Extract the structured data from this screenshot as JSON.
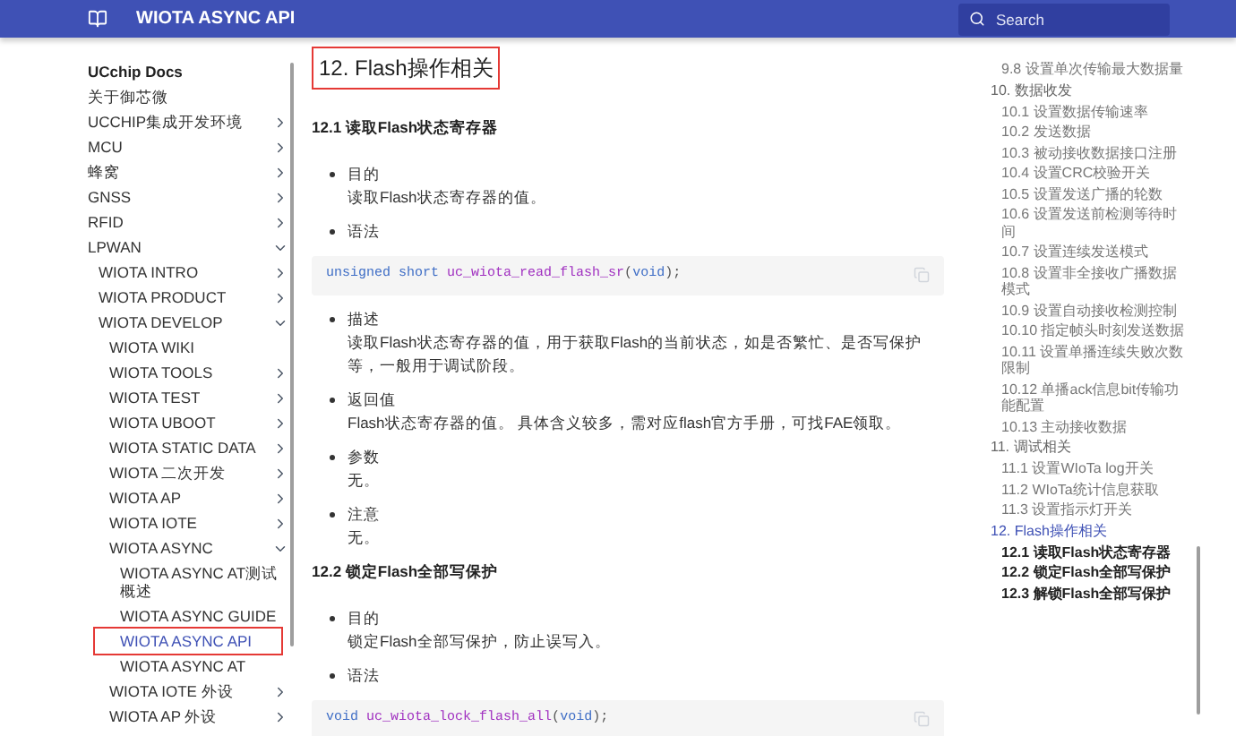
{
  "header": {
    "title": "WIOTA ASYNC API",
    "search": {
      "placeholder": "Search"
    }
  },
  "nav": {
    "title": "UCchip Docs",
    "items": [
      {
        "label": "关于御芯微",
        "selected": false
      },
      {
        "label": "UCCHIP集成开发环境",
        "expanded": false,
        "selected": false
      },
      {
        "label": "MCU",
        "expanded": false,
        "selected": false
      },
      {
        "label": "蜂窝",
        "expanded": false,
        "selected": false
      },
      {
        "label": "GNSS",
        "expanded": false,
        "selected": false
      },
      {
        "label": "RFID",
        "expanded": false,
        "selected": false
      },
      {
        "label": "LPWAN",
        "expanded": true,
        "selected": false,
        "children": [
          {
            "label": "WIOTA INTRO",
            "expanded": false,
            "selected": false
          },
          {
            "label": "WIOTA PRODUCT",
            "expanded": false,
            "selected": false
          },
          {
            "label": "WIOTA DEVELOP",
            "expanded": true,
            "selected": false,
            "children": [
              {
                "label": "WIOTA WIKI",
                "selected": false
              },
              {
                "label": "WIOTA TOOLS",
                "expanded": false,
                "selected": false
              },
              {
                "label": "WIOTA TEST",
                "expanded": false,
                "selected": false
              },
              {
                "label": "WIOTA UBOOT",
                "expanded": false,
                "selected": false
              },
              {
                "label": "WIOTA STATIC DATA",
                "expanded": false,
                "selected": false
              },
              {
                "label": "WIOTA 二次开发",
                "expanded": false,
                "selected": false
              },
              {
                "label": "WIOTA AP",
                "expanded": false,
                "selected": false
              },
              {
                "label": "WIOTA IOTE",
                "expanded": false,
                "selected": false
              },
              {
                "label": "WIOTA ASYNC",
                "expanded": true,
                "selected": false,
                "children": [
                  {
                    "label": "WIOTA ASYNC AT测试概述",
                    "selected": false
                  },
                  {
                    "label": "WIOTA ASYNC GUIDE",
                    "selected": false
                  },
                  {
                    "label": "WIOTA ASYNC API",
                    "selected": true
                  },
                  {
                    "label": "WIOTA ASYNC AT",
                    "selected": false
                  }
                ]
              },
              {
                "label": "WIOTA IOTE 外设",
                "expanded": false,
                "selected": false
              },
              {
                "label": "WIOTA AP 外设",
                "expanded": false,
                "selected": false
              }
            ]
          }
        ]
      }
    ]
  },
  "article": {
    "title": "12. Flash操作相关",
    "blocks": [
      {
        "kind": "heading",
        "text": "12.1 读取Flash状态寄存器"
      },
      {
        "kind": "bullet",
        "term": "目的",
        "text": "读取Flash状态寄存器的值。"
      },
      {
        "kind": "bullet",
        "term": "语法"
      },
      {
        "kind": "code",
        "tokens": [
          {
            "kind": "keyword",
            "text": "unsigned short"
          },
          {
            "kind": "function",
            "text": " uc_wiota_read_flash_sr"
          },
          {
            "kind": "punct",
            "text": "("
          },
          {
            "kind": "keyword",
            "text": "void"
          },
          {
            "kind": "punct",
            "text": ");"
          }
        ]
      },
      {
        "kind": "bullet",
        "term": "描述",
        "text": "读取Flash状态寄存器的值，用于获取Flash的当前状态，如是否繁忙、是否写保护等，一般用于调试阶段。"
      },
      {
        "kind": "bullet",
        "term": "返回值",
        "text": "Flash状态寄存器的值。 具体含义较多，需对应flash官方手册，可找FAE领取。"
      },
      {
        "kind": "bullet",
        "term": "参数",
        "text": "无。"
      },
      {
        "kind": "bullet",
        "term": "注意",
        "text": "无。"
      },
      {
        "kind": "heading",
        "text": "12.2 锁定Flash全部写保护"
      },
      {
        "kind": "bullet",
        "term": "目的",
        "text": "锁定Flash全部写保护，防止误写入。"
      },
      {
        "kind": "bullet",
        "term": "语法"
      },
      {
        "kind": "code",
        "tokens": [
          {
            "kind": "keyword",
            "text": "void"
          },
          {
            "kind": "function",
            "text": " uc_wiota_lock_flash_all"
          },
          {
            "kind": "punct",
            "text": "("
          },
          {
            "kind": "keyword",
            "text": "void"
          },
          {
            "kind": "punct",
            "text": ");"
          }
        ]
      }
    ]
  },
  "toc": [
    {
      "selected": false,
      "children": [
        {
          "label": "9.8 设置单次传输最大数据量",
          "selected": false
        }
      ]
    },
    {
      "label": "10. 数据收发",
      "selected": false,
      "children": [
        {
          "label": "10.1 设置数据传输速率",
          "selected": false
        },
        {
          "label": "10.2 发送数据",
          "selected": false
        },
        {
          "label": "10.3 被动接收数据接口注册",
          "selected": false
        },
        {
          "label": "10.4 设置CRC校验开关",
          "selected": false
        },
        {
          "label": "10.5 设置发送广播的轮数",
          "selected": false
        },
        {
          "label": "10.6 设置发送前检测等待时间",
          "selected": false
        },
        {
          "label": "10.7 设置连续发送模式",
          "selected": false
        },
        {
          "label": "10.8 设置非全接收广播数据模式",
          "selected": false
        },
        {
          "label": "10.9 设置自动接收检测控制",
          "selected": false
        },
        {
          "label": "10.10 指定帧头时刻发送数据",
          "selected": false
        },
        {
          "label": "10.11 设置单播连续失败次数限制",
          "selected": false
        },
        {
          "label": "10.12 单播ack信息bit传输功能配置",
          "selected": false
        },
        {
          "label": "10.13 主动接收数据",
          "selected": false
        }
      ]
    },
    {
      "label": "11. 调试相关",
      "selected": false,
      "children": [
        {
          "label": "11.1 设置WIoTa log开关",
          "selected": false
        },
        {
          "label": "11.2 WIoTa统计信息获取",
          "selected": false
        },
        {
          "label": "11.3 设置指示灯开关",
          "selected": false
        }
      ]
    },
    {
      "label": "12. Flash操作相关",
      "selected": true,
      "children": [
        {
          "label": "12.1 读取Flash状态寄存器",
          "selected": false
        },
        {
          "label": "12.2 锁定Flash全部写保护",
          "selected": false
        },
        {
          "label": "12.3 解锁Flash全部写保护",
          "selected": false
        }
      ]
    }
  ]
}
